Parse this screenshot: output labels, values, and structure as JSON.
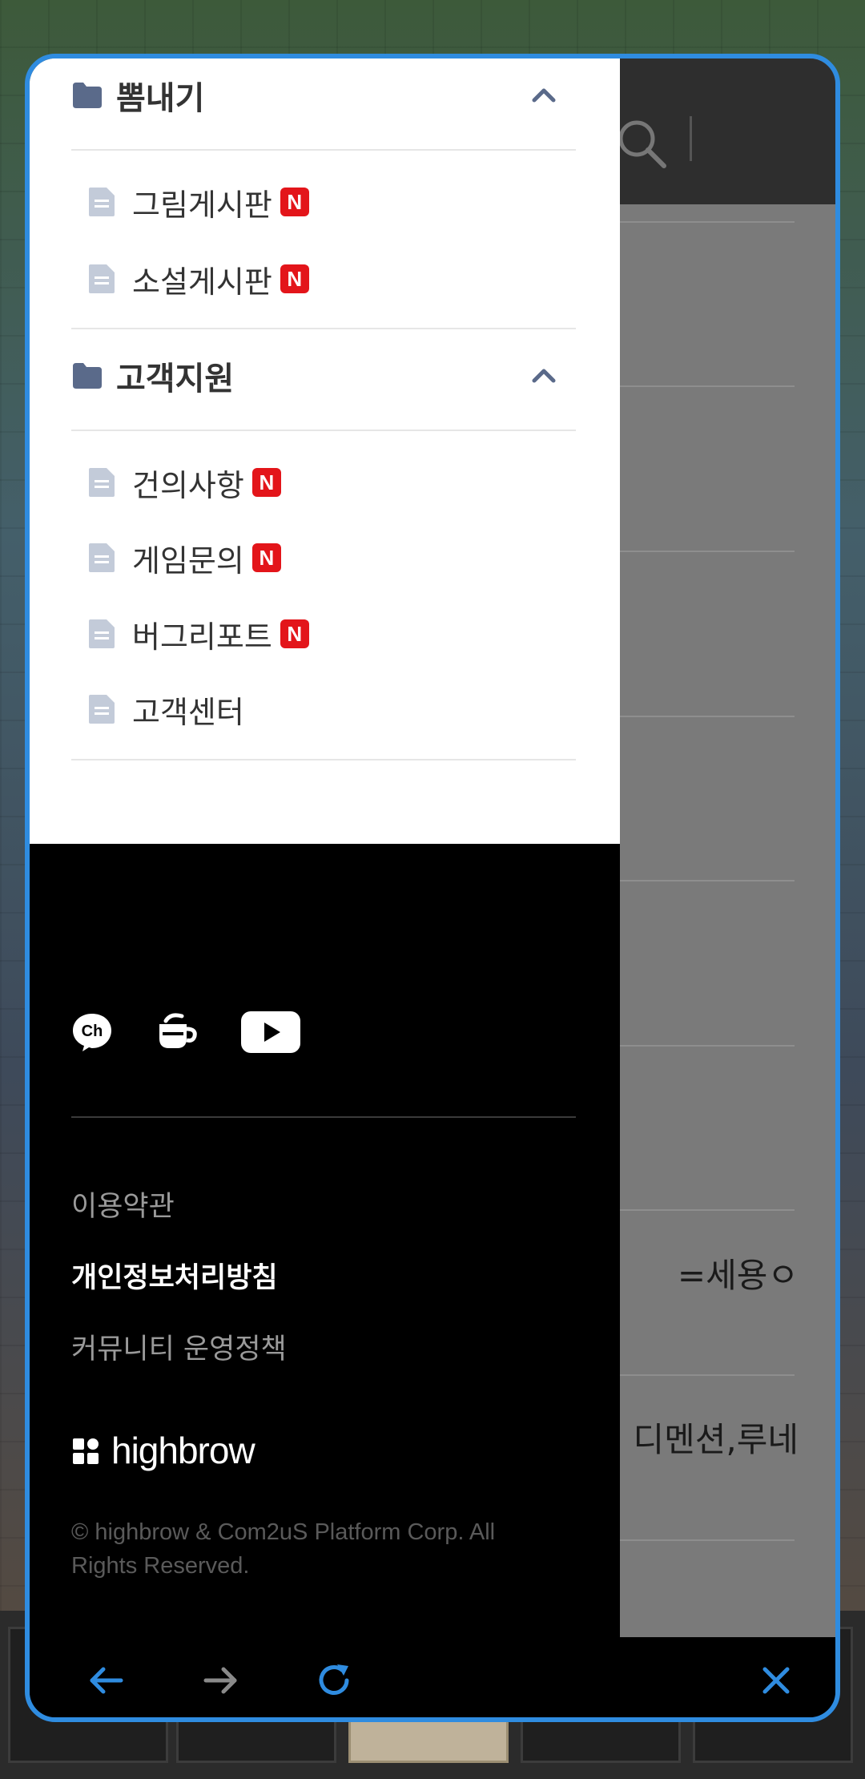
{
  "drawer": {
    "sections": [
      {
        "title": "뽐내기",
        "items": [
          {
            "label": "그림게시판",
            "badge": "N"
          },
          {
            "label": "소설게시판",
            "badge": "N"
          }
        ]
      },
      {
        "title": "고객지원",
        "items": [
          {
            "label": "건의사항",
            "badge": "N"
          },
          {
            "label": "게임문의",
            "badge": "N"
          },
          {
            "label": "버그리포트",
            "badge": "N"
          },
          {
            "label": "고객센터",
            "badge": ""
          }
        ]
      }
    ],
    "social": [
      "kakao-channel-icon",
      "cafe-icon",
      "youtube-icon"
    ],
    "policies": {
      "terms": "이용약관",
      "privacy": "개인정보처리방침",
      "community": "커뮤니티 운영정책"
    },
    "brand": "highbrow",
    "copyright": "© highbrow & Com2uS Platform Corp. All Rights Reserved."
  },
  "page": {
    "row_texts": [
      "=세용ㅇ",
      "디멘션,루네"
    ]
  },
  "colors": {
    "frame_border": "#2f8ce0",
    "badge": "#e3151a",
    "nav_icons_active": "#2f8ce0",
    "nav_icons_disabled": "#8a8a8a"
  }
}
